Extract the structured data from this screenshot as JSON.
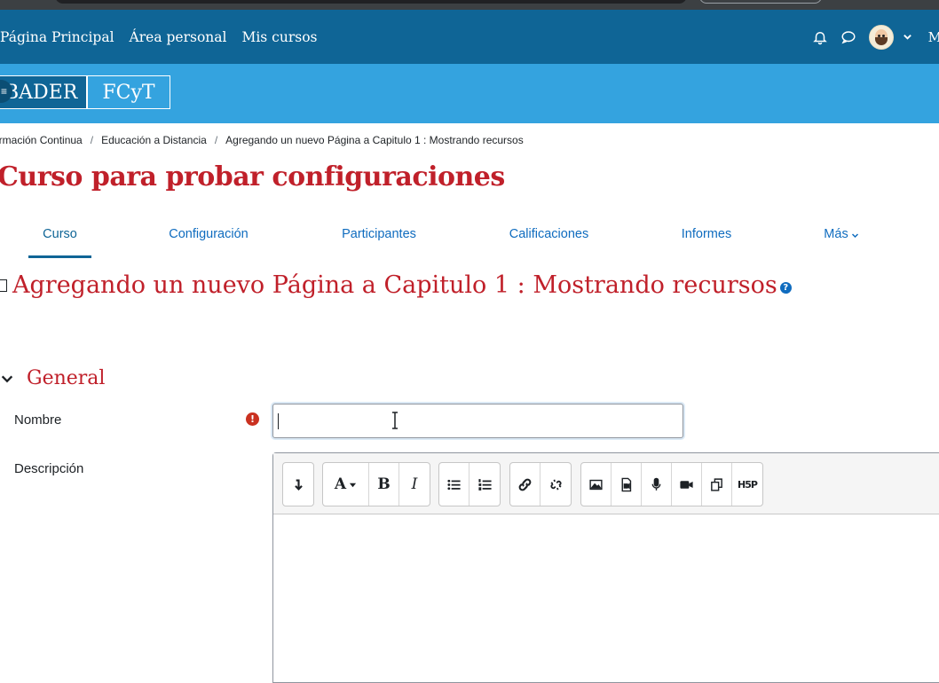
{
  "nav": {
    "links": [
      "Página Principal",
      "Área personal",
      "Mis cursos"
    ],
    "user_initial": "M",
    "icons": [
      "bell-icon",
      "chat-icon",
      "user-avatar",
      "chevron-down-icon"
    ]
  },
  "banner": {
    "logo_left": "BADER",
    "logo_right": "FCyT"
  },
  "breadcrumb": [
    "ormación Continua",
    "Educación a Distancia",
    "Agregando un nuevo Página a Capitulo 1 : Mostrando recursos"
  ],
  "course_title": "Curso para probar configuraciones",
  "tabs": [
    "Curso",
    "Configuración",
    "Participantes",
    "Calificaciones",
    "Informes",
    "Más"
  ],
  "active_tab": "Curso",
  "page_heading": "Agregando un nuevo Página a Capitulo 1 : Mostrando recursos",
  "help_icon_glyph": "?",
  "section": {
    "title": "General"
  },
  "form": {
    "name_label": "Nombre",
    "name_value": "",
    "description_label": "Descripción",
    "required_glyph": "!"
  },
  "editor": {
    "toolbar": [
      [
        "collapse-toolbar"
      ],
      [
        "font-style",
        "bold",
        "italic"
      ],
      [
        "bullet-list",
        "numbered-list"
      ],
      [
        "link",
        "unlink"
      ],
      [
        "image",
        "media",
        "record-audio",
        "record-video",
        "manage-files",
        "h5p"
      ]
    ],
    "h5p_label": "H5P",
    "font_letter": "A",
    "bold_letter": "B",
    "italic_letter": "I"
  },
  "colors": {
    "navbar": "#0f6596",
    "banner": "#34a3df",
    "heading_red": "#c0202a",
    "link_blue": "#0f6cbf"
  }
}
